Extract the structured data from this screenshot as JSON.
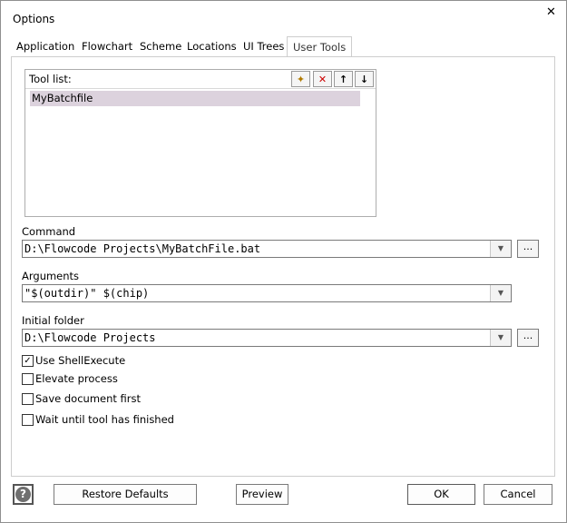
{
  "window": {
    "title": "Options",
    "close_glyph": "✕"
  },
  "tabs": [
    {
      "label": "Application"
    },
    {
      "label": "Flowchart"
    },
    {
      "label": "Scheme"
    },
    {
      "label": "Locations"
    },
    {
      "label": "UI Trees"
    },
    {
      "label": "User Tools"
    }
  ],
  "active_tab": "User Tools",
  "tool_list": {
    "label": "Tool list:",
    "buttons": [
      {
        "name": "new-tool",
        "icon": "folder-star-icon",
        "glyph": "✦"
      },
      {
        "name": "delete-tool",
        "icon": "delete-x-icon",
        "glyph": "✕"
      },
      {
        "name": "move-up",
        "icon": "arrow-up-icon",
        "glyph": "↑"
      },
      {
        "name": "move-down",
        "icon": "arrow-down-icon",
        "glyph": "↓"
      }
    ],
    "items": [
      "MyBatchfile"
    ],
    "selected": "MyBatchfile"
  },
  "command": {
    "label": "Command",
    "value": "D:\\Flowcode Projects\\MyBatchFile.bat",
    "browse": "..."
  },
  "arguments": {
    "label": "Arguments",
    "value": "\"$(outdir)\" $(chip)"
  },
  "initial_folder": {
    "label": "Initial folder",
    "value": "D:\\Flowcode Projects",
    "browse": "..."
  },
  "options": [
    {
      "label": "Use ShellExecute",
      "checked": true
    },
    {
      "label": "Elevate process",
      "checked": false
    },
    {
      "label": "Save document first",
      "checked": false
    },
    {
      "label": "Wait until tool has finished",
      "checked": false
    }
  ],
  "buttons": {
    "help": "?",
    "restore_defaults": "Restore Defaults",
    "preview": "Preview",
    "ok": "OK",
    "cancel": "Cancel"
  },
  "colors": {
    "selection": "#dcd2dd",
    "delete_red": "#cc0000"
  }
}
